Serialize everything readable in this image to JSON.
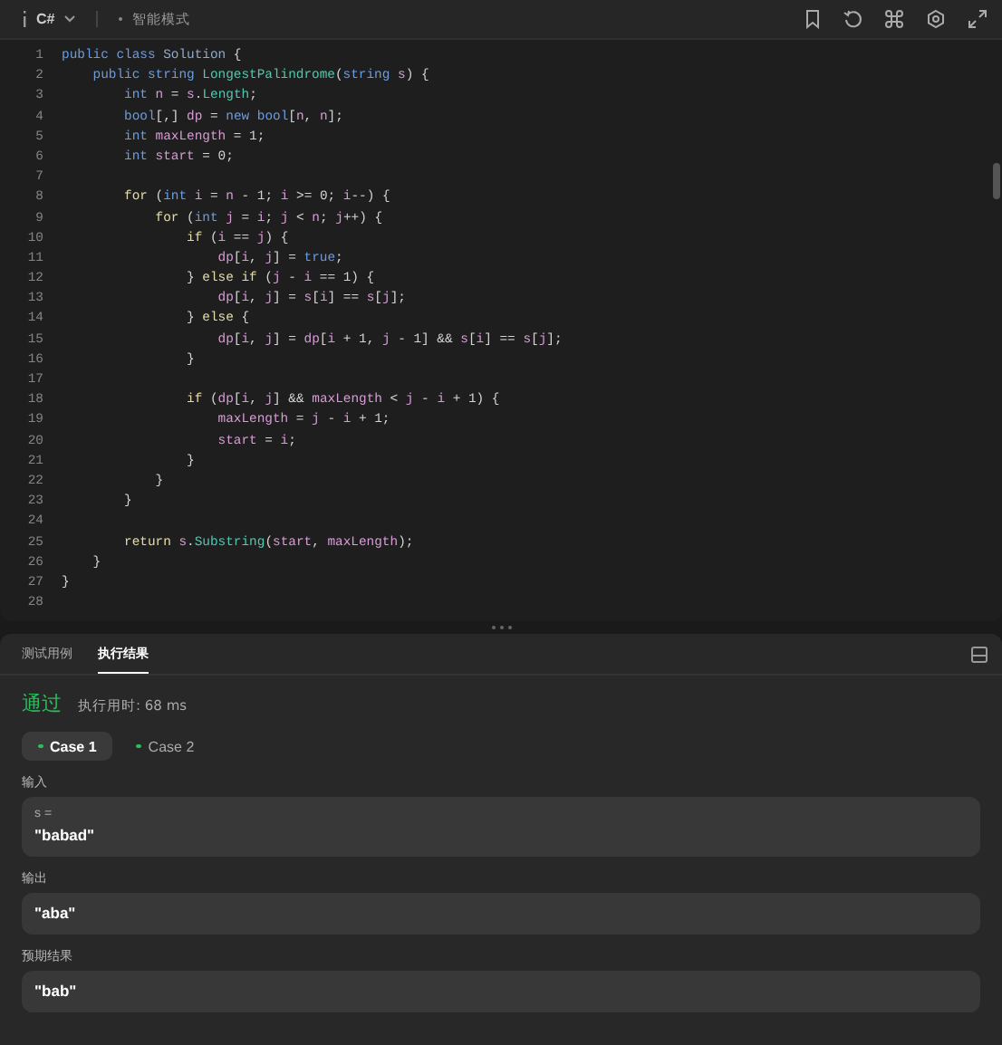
{
  "toolbar": {
    "language": "C#",
    "mode": "智能模式"
  },
  "code": {
    "lines": [
      {
        "number": "1",
        "segments": [
          {
            "kind": "kw",
            "text": "public class "
          },
          {
            "kind": "type",
            "text": "Solution"
          },
          {
            "kind": "p",
            "text": " {"
          }
        ]
      },
      {
        "number": "2",
        "segments": [
          {
            "kind": "kw",
            "text": "    public string "
          },
          {
            "kind": "fn",
            "text": "LongestPalindrome"
          },
          {
            "kind": "p",
            "text": "("
          },
          {
            "kind": "kw",
            "text": "string "
          },
          {
            "kind": "v",
            "text": "s"
          },
          {
            "kind": "p",
            "text": ") {"
          }
        ]
      },
      {
        "number": "3",
        "segments": [
          {
            "kind": "kw",
            "text": "        int "
          },
          {
            "kind": "v",
            "text": "n"
          },
          {
            "kind": "p",
            "text": " = "
          },
          {
            "kind": "v",
            "text": "s"
          },
          {
            "kind": "p",
            "text": "."
          },
          {
            "kind": "fn",
            "text": "Length"
          },
          {
            "kind": "p",
            "text": ";"
          }
        ]
      },
      {
        "number": "4",
        "segments": [
          {
            "kind": "kw",
            "text": "        bool"
          },
          {
            "kind": "p",
            "text": "[,] "
          },
          {
            "kind": "v",
            "text": "dp"
          },
          {
            "kind": "p",
            "text": " = "
          },
          {
            "kind": "kw",
            "text": "new bool"
          },
          {
            "kind": "p",
            "text": "["
          },
          {
            "kind": "v",
            "text": "n"
          },
          {
            "kind": "p",
            "text": ", "
          },
          {
            "kind": "v",
            "text": "n"
          },
          {
            "kind": "p",
            "text": "];"
          }
        ]
      },
      {
        "number": "5",
        "segments": [
          {
            "kind": "kw",
            "text": "        int "
          },
          {
            "kind": "v",
            "text": "maxLength"
          },
          {
            "kind": "p",
            "text": " = 1;"
          }
        ]
      },
      {
        "number": "6",
        "segments": [
          {
            "kind": "kw",
            "text": "        int "
          },
          {
            "kind": "v",
            "text": "start"
          },
          {
            "kind": "p",
            "text": " = 0;"
          }
        ]
      },
      {
        "number": "7"
      },
      {
        "number": "8",
        "segments": [
          {
            "kind": "ctl",
            "text": "        for "
          },
          {
            "kind": "p",
            "text": "("
          },
          {
            "kind": "kw",
            "text": "int "
          },
          {
            "kind": "v",
            "text": "i"
          },
          {
            "kind": "p",
            "text": " = "
          },
          {
            "kind": "v",
            "text": "n"
          },
          {
            "kind": "p",
            "text": " - 1; "
          },
          {
            "kind": "v",
            "text": "i"
          },
          {
            "kind": "p",
            "text": " >= 0; "
          },
          {
            "kind": "v",
            "text": "i"
          },
          {
            "kind": "p",
            "text": "--) {"
          }
        ]
      },
      {
        "number": "9",
        "segments": [
          {
            "kind": "ctl",
            "text": "            for "
          },
          {
            "kind": "p",
            "text": "("
          },
          {
            "kind": "kw",
            "text": "int "
          },
          {
            "kind": "v",
            "text": "j"
          },
          {
            "kind": "p",
            "text": " = "
          },
          {
            "kind": "v",
            "text": "i"
          },
          {
            "kind": "p",
            "text": "; "
          },
          {
            "kind": "v",
            "text": "j"
          },
          {
            "kind": "p",
            "text": " < "
          },
          {
            "kind": "v",
            "text": "n"
          },
          {
            "kind": "p",
            "text": "; "
          },
          {
            "kind": "v",
            "text": "j"
          },
          {
            "kind": "p",
            "text": "++) {"
          }
        ]
      },
      {
        "number": "10",
        "segments": [
          {
            "kind": "ctl",
            "text": "                if "
          },
          {
            "kind": "p",
            "text": "("
          },
          {
            "kind": "v",
            "text": "i"
          },
          {
            "kind": "p",
            "text": " == "
          },
          {
            "kind": "v",
            "text": "j"
          },
          {
            "kind": "p",
            "text": ") {"
          }
        ]
      },
      {
        "number": "11",
        "segments": [
          {
            "kind": "v",
            "text": "                    dp"
          },
          {
            "kind": "p",
            "text": "["
          },
          {
            "kind": "v",
            "text": "i"
          },
          {
            "kind": "p",
            "text": ", "
          },
          {
            "kind": "v",
            "text": "j"
          },
          {
            "kind": "p",
            "text": "] = "
          },
          {
            "kind": "kw",
            "text": "true"
          },
          {
            "kind": "p",
            "text": ";"
          }
        ]
      },
      {
        "number": "12",
        "segments": [
          {
            "kind": "p",
            "text": "                } "
          },
          {
            "kind": "ctl",
            "text": "else if "
          },
          {
            "kind": "p",
            "text": "("
          },
          {
            "kind": "v",
            "text": "j"
          },
          {
            "kind": "p",
            "text": " - "
          },
          {
            "kind": "v",
            "text": "i"
          },
          {
            "kind": "p",
            "text": " == 1) {"
          }
        ]
      },
      {
        "number": "13",
        "segments": [
          {
            "kind": "v",
            "text": "                    dp"
          },
          {
            "kind": "p",
            "text": "["
          },
          {
            "kind": "v",
            "text": "i"
          },
          {
            "kind": "p",
            "text": ", "
          },
          {
            "kind": "v",
            "text": "j"
          },
          {
            "kind": "p",
            "text": "] = "
          },
          {
            "kind": "v",
            "text": "s"
          },
          {
            "kind": "p",
            "text": "["
          },
          {
            "kind": "v",
            "text": "i"
          },
          {
            "kind": "p",
            "text": "] == "
          },
          {
            "kind": "v",
            "text": "s"
          },
          {
            "kind": "p",
            "text": "["
          },
          {
            "kind": "v",
            "text": "j"
          },
          {
            "kind": "p",
            "text": "];"
          }
        ]
      },
      {
        "number": "14",
        "segments": [
          {
            "kind": "p",
            "text": "                } "
          },
          {
            "kind": "ctl",
            "text": "else"
          },
          {
            "kind": "p",
            "text": " {"
          }
        ]
      },
      {
        "number": "15",
        "segments": [
          {
            "kind": "v",
            "text": "                    dp"
          },
          {
            "kind": "p",
            "text": "["
          },
          {
            "kind": "v",
            "text": "i"
          },
          {
            "kind": "p",
            "text": ", "
          },
          {
            "kind": "v",
            "text": "j"
          },
          {
            "kind": "p",
            "text": "] = "
          },
          {
            "kind": "v",
            "text": "dp"
          },
          {
            "kind": "p",
            "text": "["
          },
          {
            "kind": "v",
            "text": "i"
          },
          {
            "kind": "p",
            "text": " + 1, "
          },
          {
            "kind": "v",
            "text": "j"
          },
          {
            "kind": "p",
            "text": " - 1] && "
          },
          {
            "kind": "v",
            "text": "s"
          },
          {
            "kind": "p",
            "text": "["
          },
          {
            "kind": "v",
            "text": "i"
          },
          {
            "kind": "p",
            "text": "] == "
          },
          {
            "kind": "v",
            "text": "s"
          },
          {
            "kind": "p",
            "text": "["
          },
          {
            "kind": "v",
            "text": "j"
          },
          {
            "kind": "p",
            "text": "];"
          }
        ]
      },
      {
        "number": "16",
        "segments": [
          {
            "kind": "p",
            "text": "                }"
          }
        ]
      },
      {
        "number": "17"
      },
      {
        "number": "18",
        "segments": [
          {
            "kind": "ctl",
            "text": "                if "
          },
          {
            "kind": "p",
            "text": "("
          },
          {
            "kind": "v",
            "text": "dp"
          },
          {
            "kind": "p",
            "text": "["
          },
          {
            "kind": "v",
            "text": "i"
          },
          {
            "kind": "p",
            "text": ", "
          },
          {
            "kind": "v",
            "text": "j"
          },
          {
            "kind": "p",
            "text": "] && "
          },
          {
            "kind": "v",
            "text": "maxLength"
          },
          {
            "kind": "p",
            "text": " < "
          },
          {
            "kind": "v",
            "text": "j"
          },
          {
            "kind": "p",
            "text": " - "
          },
          {
            "kind": "v",
            "text": "i"
          },
          {
            "kind": "p",
            "text": " + 1) {"
          }
        ]
      },
      {
        "number": "19",
        "segments": [
          {
            "kind": "v",
            "text": "                    maxLength"
          },
          {
            "kind": "p",
            "text": " = "
          },
          {
            "kind": "v",
            "text": "j"
          },
          {
            "kind": "p",
            "text": " - "
          },
          {
            "kind": "v",
            "text": "i"
          },
          {
            "kind": "p",
            "text": " + 1;"
          }
        ]
      },
      {
        "number": "20",
        "segments": [
          {
            "kind": "v",
            "text": "                    start"
          },
          {
            "kind": "p",
            "text": " = "
          },
          {
            "kind": "v",
            "text": "i"
          },
          {
            "kind": "p",
            "text": ";"
          }
        ]
      },
      {
        "number": "21",
        "segments": [
          {
            "kind": "p",
            "text": "                }"
          }
        ]
      },
      {
        "number": "22",
        "segments": [
          {
            "kind": "p",
            "text": "            }"
          }
        ]
      },
      {
        "number": "23",
        "segments": [
          {
            "kind": "p",
            "text": "        }"
          }
        ]
      },
      {
        "number": "24"
      },
      {
        "number": "25",
        "segments": [
          {
            "kind": "ctl",
            "text": "        return "
          },
          {
            "kind": "v",
            "text": "s"
          },
          {
            "kind": "p",
            "text": "."
          },
          {
            "kind": "fn",
            "text": "Substring"
          },
          {
            "kind": "p",
            "text": "("
          },
          {
            "kind": "v",
            "text": "start"
          },
          {
            "kind": "p",
            "text": ", "
          },
          {
            "kind": "v",
            "text": "maxLength"
          },
          {
            "kind": "p",
            "text": ");"
          }
        ]
      },
      {
        "number": "26",
        "segments": [
          {
            "kind": "p",
            "text": "    }"
          }
        ]
      },
      {
        "number": "27",
        "segments": [
          {
            "kind": "p",
            "text": "}"
          }
        ]
      },
      {
        "number": "28"
      }
    ]
  },
  "result_panel": {
    "tabs": [
      {
        "label": "测试用例",
        "selected": false
      },
      {
        "label": "执行结果",
        "selected": true
      }
    ],
    "status": "通过",
    "runtime": "执行用时: 68 ms",
    "cases": [
      {
        "label": "Case 1",
        "selected": true
      },
      {
        "label": "Case 2",
        "selected": false
      }
    ],
    "sections": [
      {
        "label": "输入",
        "var_name": "s =",
        "value": "\"babad\""
      },
      {
        "label": "输出",
        "value": "\"aba\""
      },
      {
        "label": "预期结果",
        "value": "\"bab\""
      }
    ]
  }
}
